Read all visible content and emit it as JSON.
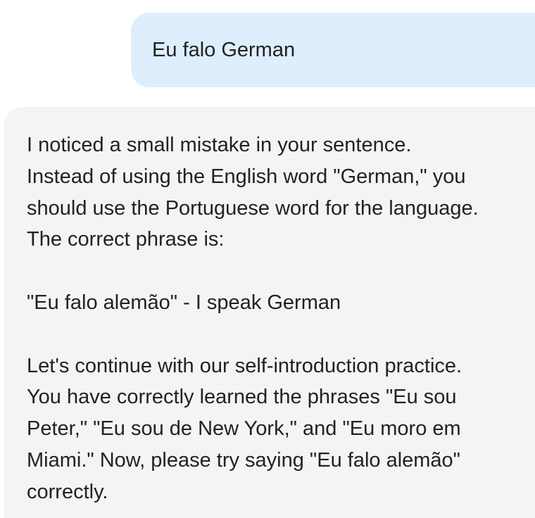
{
  "conversation": {
    "user_message": "Eu falo German",
    "assistant_message": {
      "paragraph_1": [
        "I noticed a small mistake in your sentence.",
        "Instead of using the English word \"German,\" you",
        "should use the Portuguese word for the language.",
        "The correct phrase is:"
      ],
      "paragraph_2": [
        "\"Eu falo alemão\" - I speak German"
      ],
      "paragraph_3": [
        "Let's continue with our self-introduction practice.",
        "You have correctly learned the phrases \"Eu sou",
        "Peter,\" \"Eu sou de New York,\" and \"Eu moro em",
        "Miami.\" Now, please try saying \"Eu falo alemão\"",
        "correctly."
      ]
    }
  }
}
